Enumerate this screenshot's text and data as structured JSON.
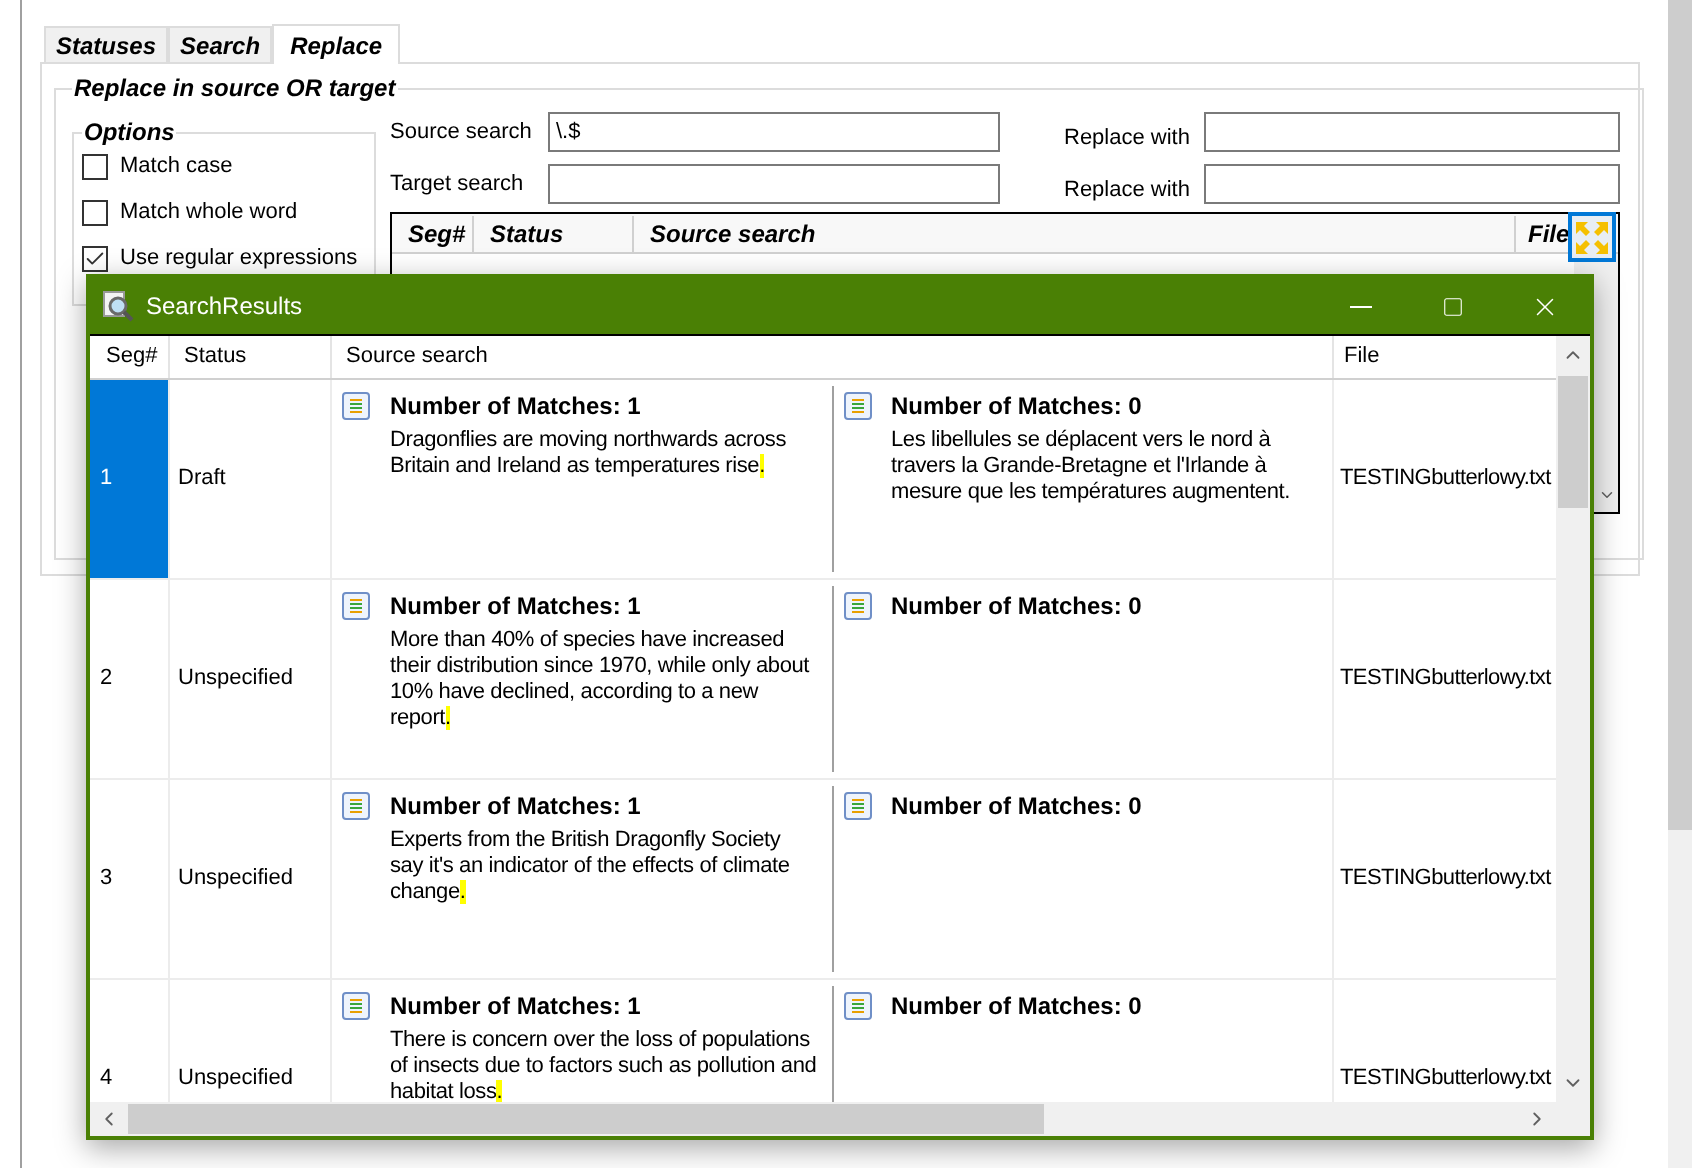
{
  "tabs": [
    {
      "label": "Statuses",
      "selected": false
    },
    {
      "label": "Search",
      "selected": false
    },
    {
      "label": "Replace",
      "selected": true
    }
  ],
  "group_title": "Replace in source OR target",
  "options": {
    "title": "Options",
    "items": [
      {
        "label": "Match case",
        "checked": false
      },
      {
        "label": "Match whole word",
        "checked": false
      },
      {
        "label": "Use regular expressions",
        "checked": true
      }
    ]
  },
  "source_search": {
    "label": "Source search",
    "value": "\\.$",
    "replace_label": "Replace with"
  },
  "target_search": {
    "label": "Target search",
    "replace_label": "Replace with"
  },
  "grid": {
    "columns": [
      "Seg#",
      "Status",
      "Source search",
      "File"
    ]
  },
  "results": {
    "title": "SearchResults",
    "columns": [
      "Seg#",
      "Status",
      "Source search",
      "File"
    ],
    "rows": [
      {
        "seg": "1",
        "status": "Draft",
        "selected": true,
        "source": {
          "matches": "Number of Matches: 1",
          "text": "Dragonflies are moving northwards across Britain and Ireland as temperatures rise",
          "match": "."
        },
        "target": {
          "matches": "Number of Matches: 0",
          "text": "Les libellules se déplacent vers le nord à travers la Grande-Bretagne et l'Irlande à mesure que les températures augmentent."
        },
        "file": "TESTINGbutterlowy.txt"
      },
      {
        "seg": "2",
        "status": "Unspecified",
        "selected": false,
        "source": {
          "matches": "Number of Matches: 1",
          "text": "More than 40% of species have increased their distribution since 1970, while only about 10% have declined, according to a new report",
          "match": "."
        },
        "target": {
          "matches": "Number of Matches: 0"
        },
        "file": "TESTINGbutterlowy.txt"
      },
      {
        "seg": "3",
        "status": "Unspecified",
        "selected": false,
        "source": {
          "matches": "Number of Matches: 1",
          "text": "Experts from the British Dragonfly Society say it's an indicator of the effects of climate change",
          "match": "."
        },
        "target": {
          "matches": "Number of Matches: 0"
        },
        "file": "TESTINGbutterlowy.txt"
      },
      {
        "seg": "4",
        "status": "Unspecified",
        "selected": false,
        "source": {
          "matches": "Number of Matches: 1",
          "text": "There is concern over the loss of populations of insects due to factors such as pollution and habitat loss",
          "match": "."
        },
        "target": {
          "matches": "Number of Matches: 0"
        },
        "file": "TESTINGbutterlowy.txt"
      }
    ]
  }
}
